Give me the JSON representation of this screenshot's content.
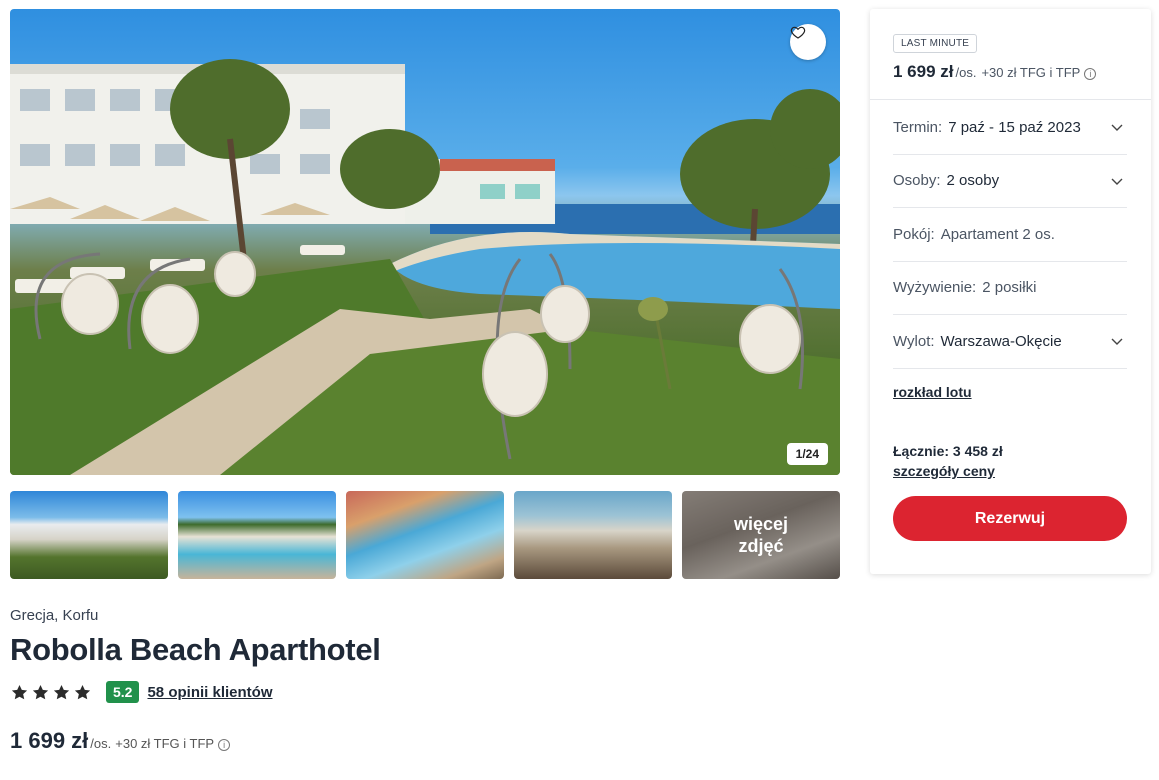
{
  "gallery": {
    "counter": "1/24",
    "more_photos": "więcej zdjęć",
    "favorite_icon": "heart-icon"
  },
  "hotel": {
    "location": "Grecja, Korfu",
    "name": "Robolla Beach Aparthotel",
    "stars": 4,
    "score": "5.2",
    "reviews": "58 opinii klientów"
  },
  "price_line": {
    "amount": "1 699 zł",
    "per": "/os.",
    "extra": "+30 zł TFG i TFP",
    "info_icon": "info-icon"
  },
  "booking": {
    "badge": "LAST MINUTE",
    "price": "1 699 zł",
    "per": "/os.",
    "extra": "+30 zł TFG i TFP",
    "rows": [
      {
        "label": "Termin:",
        "value": "7 paź - 15 paź 2023",
        "dropdown": true
      },
      {
        "label": "Osoby:",
        "value": "2 osoby",
        "dropdown": true
      },
      {
        "label": "Pokój:",
        "value": "Apartament 2 os.",
        "dropdown": false
      },
      {
        "label": "Wyżywienie:",
        "value": "2 posiłki",
        "dropdown": false
      },
      {
        "label": "Wylot:",
        "value": "Warszawa-Okęcie",
        "dropdown": true
      }
    ],
    "flight_link": "rozkład lotu",
    "total": "Łącznie: 3 458 zł",
    "price_details": "szczegóły ceny",
    "book_button": "Rezerwuj"
  },
  "colors": {
    "accent": "#dc2430",
    "score": "#21914b"
  }
}
